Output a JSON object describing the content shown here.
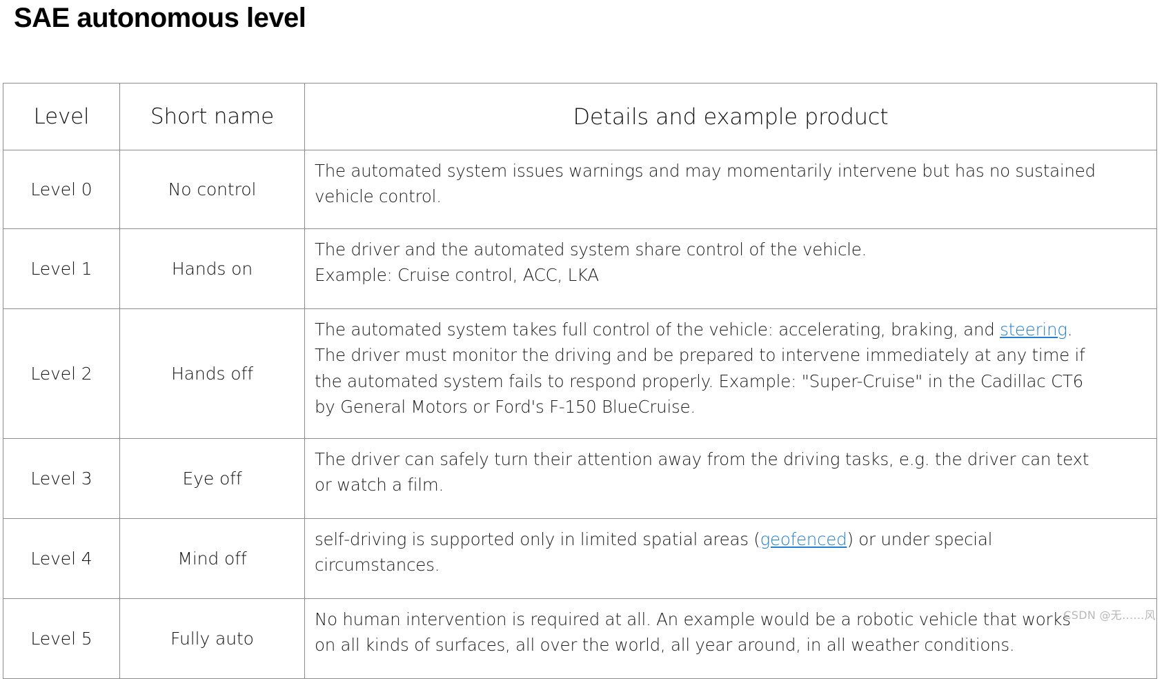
{
  "page": {
    "title": "SAE autonomous level",
    "watermark": "CSDN @无……风"
  },
  "colors": {
    "link": "#1f7fd4",
    "border": "#8c8c8c",
    "text": "#1b1b1b",
    "watermark": "#b8b8b8"
  },
  "table": {
    "headers": {
      "level": "Level",
      "short_name": "Short name",
      "details": "Details and example product"
    },
    "rows": [
      {
        "level": "Level 0",
        "short_name": "No control",
        "details_lines": [
          "The automated system issues warnings and may momentarily intervene but has no sustained",
          "vehicle control."
        ]
      },
      {
        "level": "Level 1",
        "short_name": "Hands on",
        "details_lines": [
          " The driver and the automated system share control of the vehicle.",
          "Example: Cruise control, ACC, LKA"
        ]
      },
      {
        "level": "Level 2",
        "short_name": "Hands off",
        "details_lines": [
          "The automated system takes full control of the vehicle: accelerating, braking, and ",
          "The driver must monitor the driving and be prepared to intervene immediately at any time if",
          "the automated system fails to respond properly.  Example:  \"Super-Cruise\" in the Cadillac CT6",
          "by General Motors or Ford's F-150 BlueCruise."
        ],
        "link_text": "steering",
        "line1_suffix": "."
      },
      {
        "level": "Level 3",
        "short_name": "Eye off",
        "details_lines": [
          "The driver can safely turn their attention away from the driving tasks, e.g. the driver can text",
          "or watch a film."
        ]
      },
      {
        "level": "Level 4",
        "short_name": "Mind off",
        "details_lines": [
          "self-driving is supported only in limited spatial areas (",
          ") or under special",
          "circumstances."
        ],
        "link_text": "geofenced"
      },
      {
        "level": "Level 5",
        "short_name": "Fully auto",
        "details_lines": [
          "No human intervention is required at all. An example would be a robotic vehicle that works",
          "on all kinds of surfaces, all over the world, all year around, in all weather conditions."
        ]
      }
    ]
  }
}
